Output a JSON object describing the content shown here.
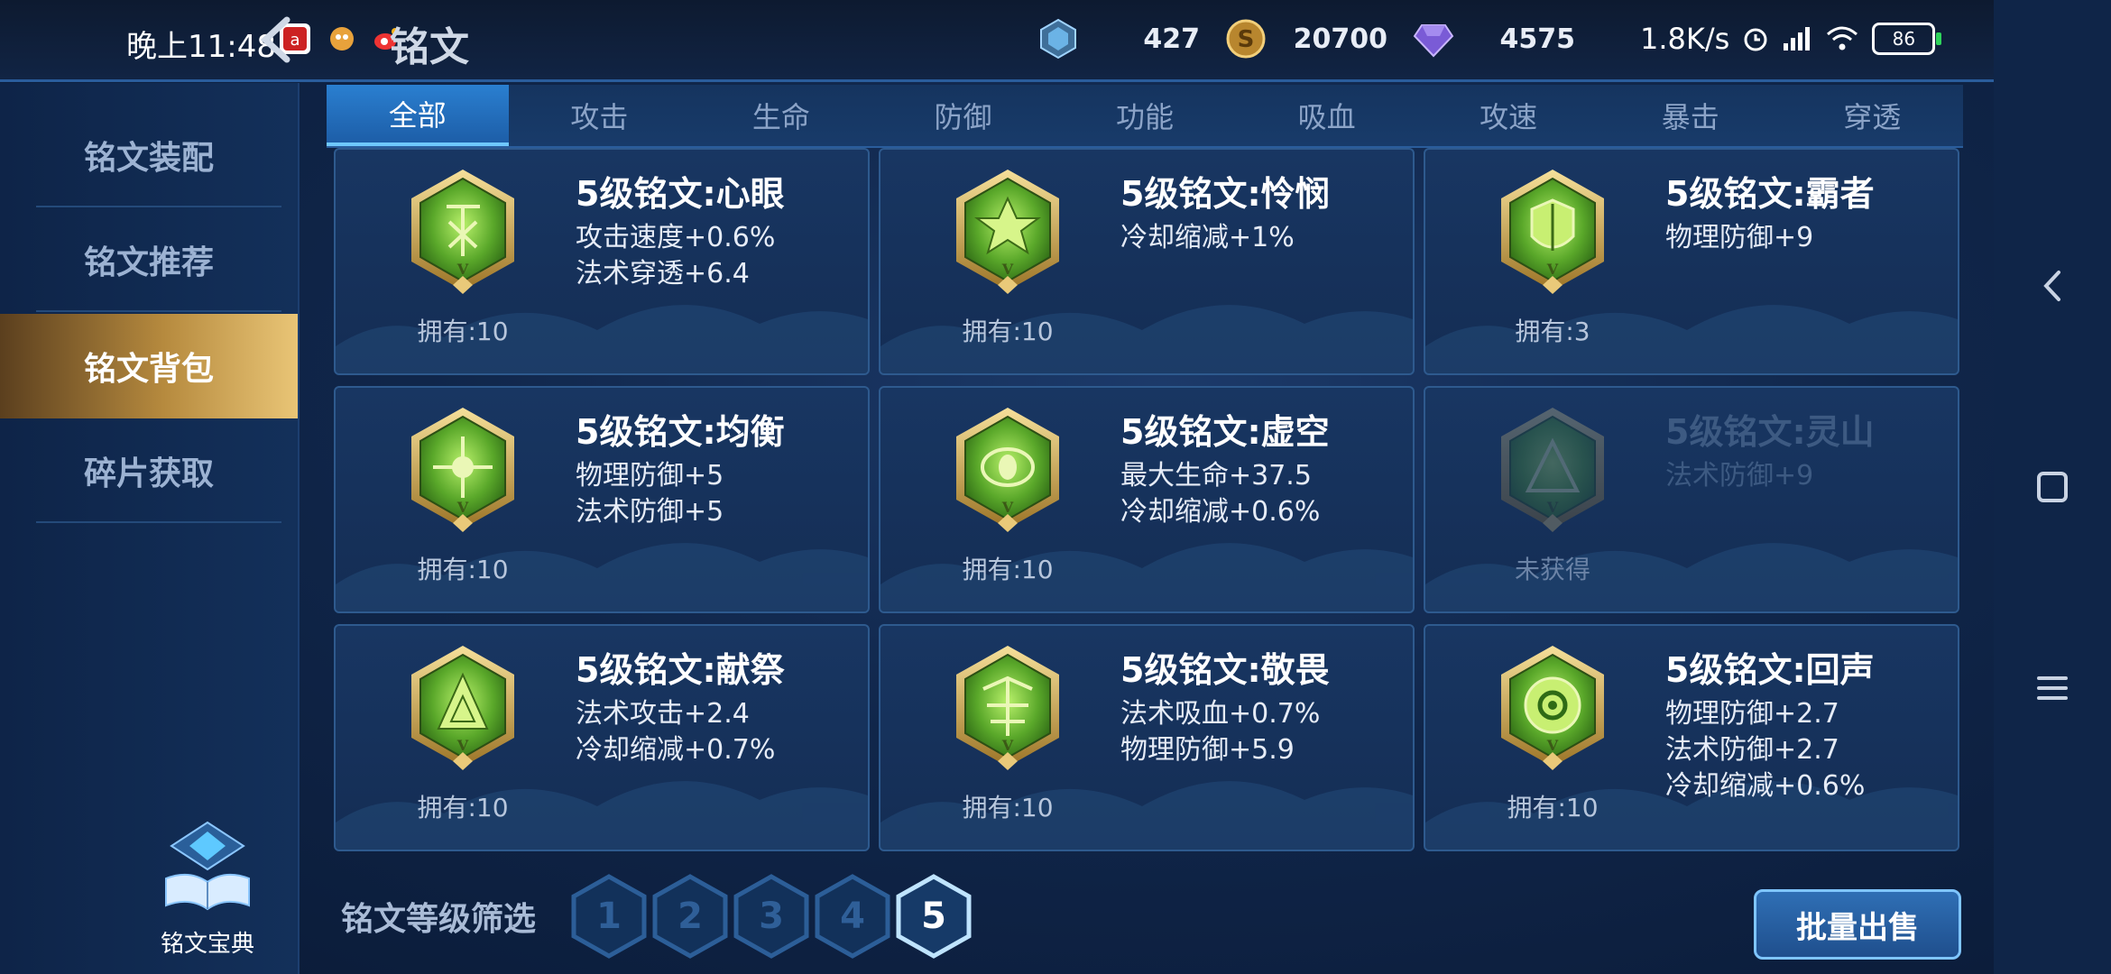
{
  "status": {
    "time": "晚上11:48",
    "net_speed": "1.8K/s",
    "battery": "86"
  },
  "header": {
    "title": "铭文",
    "currencies": [
      {
        "icon": "crystal-icon",
        "value": "427"
      },
      {
        "icon": "gold-coin-icon",
        "value": "20700"
      },
      {
        "icon": "purple-gem-icon",
        "value": "4575"
      }
    ]
  },
  "sidebar": {
    "items": [
      {
        "label": "铭文装配"
      },
      {
        "label": "铭文推荐"
      },
      {
        "label": "铭文背包"
      },
      {
        "label": "碎片获取"
      }
    ],
    "codex_label": "铭文宝典"
  },
  "tabs": [
    "全部",
    "攻击",
    "生命",
    "防御",
    "功能",
    "吸血",
    "攻速",
    "暴击",
    "穿透"
  ],
  "runes": [
    {
      "name": "5级铭文:心眼",
      "attrs": [
        "攻击速度+0.6%",
        "法术穿透+6.4"
      ],
      "owned": "拥有:10"
    },
    {
      "name": "5级铭文:怜悯",
      "attrs": [
        "冷却缩减+1%"
      ],
      "owned": "拥有:10"
    },
    {
      "name": "5级铭文:霸者",
      "attrs": [
        "物理防御+9"
      ],
      "owned": "拥有:3"
    },
    {
      "name": "5级铭文:均衡",
      "attrs": [
        "物理防御+5",
        "法术防御+5"
      ],
      "owned": "拥有:10"
    },
    {
      "name": "5级铭文:虚空",
      "attrs": [
        "最大生命+37.5",
        "冷却缩减+0.6%"
      ],
      "owned": "拥有:10"
    },
    {
      "name": "5级铭文:灵山",
      "attrs": [
        "法术防御+9"
      ],
      "owned": "未获得"
    },
    {
      "name": "5级铭文:献祭",
      "attrs": [
        "法术攻击+2.4",
        "冷却缩减+0.7%"
      ],
      "owned": "拥有:10"
    },
    {
      "name": "5级铭文:敬畏",
      "attrs": [
        "法术吸血+0.7%",
        "物理防御+5.9"
      ],
      "owned": "拥有:10"
    },
    {
      "name": "5级铭文:回声",
      "attrs": [
        "物理防御+2.7",
        "法术防御+2.7",
        "冷却缩减+0.6%"
      ],
      "owned": "拥有:10"
    }
  ],
  "filter": {
    "label": "铭文等级筛选",
    "levels": [
      "1",
      "2",
      "3",
      "4",
      "5"
    ],
    "selected": "5"
  },
  "actions": {
    "bulk_sell": "批量出售"
  }
}
